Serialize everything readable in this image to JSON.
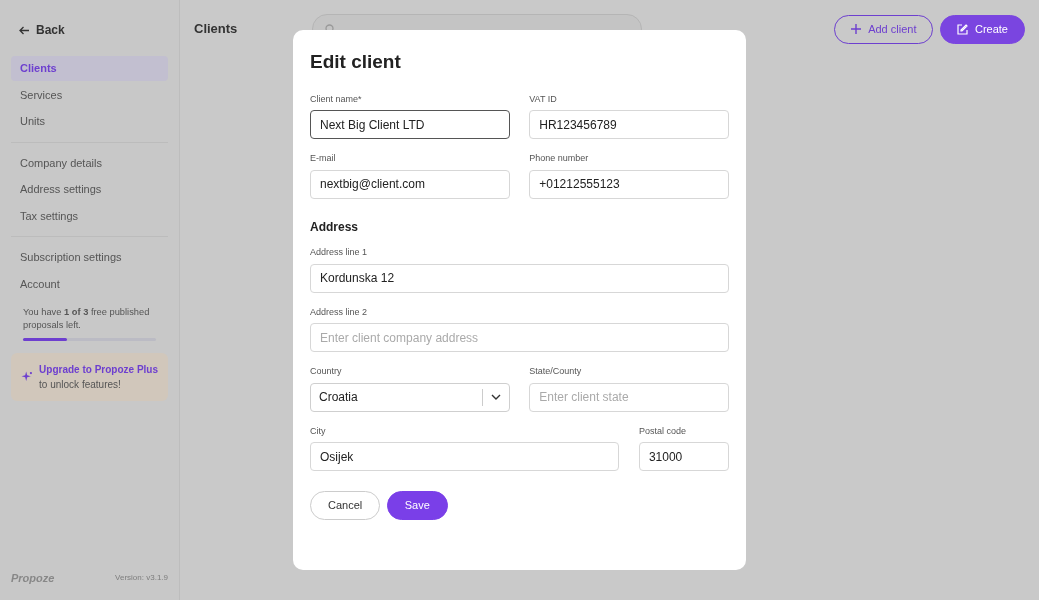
{
  "sidebar": {
    "back": "Back",
    "groups": [
      [
        {
          "label": "Clients",
          "selected": true
        },
        {
          "label": "Services",
          "selected": false
        },
        {
          "label": "Units",
          "selected": false
        }
      ],
      [
        {
          "label": "Company details",
          "selected": false
        },
        {
          "label": "Address settings",
          "selected": false
        },
        {
          "label": "Tax settings",
          "selected": false
        }
      ],
      [
        {
          "label": "Subscription settings",
          "selected": false
        },
        {
          "label": "Account",
          "selected": false
        }
      ]
    ],
    "usage": {
      "text": "You have **1 of 3** free published proposals left.",
      "level": 0.33
    },
    "upgrade": {
      "title": "Upgrade to Propoze Plus",
      "text": "to unlock features!"
    },
    "logo": "Propoze",
    "version": "Version: v3.1.9"
  },
  "header": {
    "title": "Clients",
    "buttons": [
      {
        "label": "Add client",
        "kind": "outline"
      },
      {
        "label": "Create",
        "kind": "primary"
      }
    ]
  },
  "modal": {
    "title": "Edit client",
    "sections": [
      {
        "rows": [
          [
            {
              "kind": "text",
              "label": "Client name*",
              "value": "Next Big Client LTD",
              "focused": true
            },
            {
              "kind": "text",
              "label": "VAT ID",
              "value": "HR123456789",
              "focused": false
            }
          ],
          [
            {
              "kind": "text",
              "label": "E-mail",
              "value": "nextbig@client.com",
              "focused": false
            },
            {
              "kind": "text",
              "label": "Phone number",
              "value": "+01212555123",
              "focused": false
            }
          ]
        ]
      },
      {
        "heading": "Address",
        "rows": [
          [
            {
              "kind": "text",
              "label": "Address line 1",
              "value": "Kordunska 12",
              "focused": false
            }
          ],
          [
            {
              "kind": "text",
              "label": "Address line 2",
              "placeholder": "Enter client company address",
              "focused": false
            }
          ],
          [
            {
              "kind": "select",
              "label": "Country",
              "value": "Croatia",
              "focused": false
            },
            {
              "kind": "text",
              "label": "State/County",
              "placeholder": "Enter client state",
              "focused": false
            }
          ],
          [
            {
              "kind": "text",
              "label": "City",
              "value": "Osijek",
              "focused": false
            },
            {
              "kind": "text",
              "label": "Postal code",
              "value": "31000",
              "focused": false
            }
          ]
        ]
      }
    ],
    "buttons": [
      {
        "label": "Cancel",
        "kind": "outline"
      },
      {
        "label": "Save",
        "kind": "primary"
      }
    ]
  }
}
